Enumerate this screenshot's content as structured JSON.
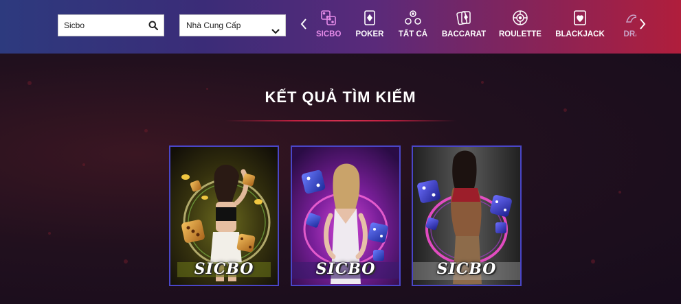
{
  "header": {
    "search": {
      "value": "Sicbo",
      "placeholder": "Sicbo",
      "icon": "search-icon"
    },
    "provider_select": {
      "selected": "Nhà Cung Cấp",
      "icon": "chevron-down-icon"
    },
    "categories": [
      {
        "label": "SICBO",
        "icon": "dice-icon",
        "active": true
      },
      {
        "label": "POKER",
        "icon": "playing-card-icon",
        "active": false
      },
      {
        "label": "TẤT CẢ",
        "icon": "all-games-icon",
        "active": false
      },
      {
        "label": "BACCARAT",
        "icon": "cards-icon",
        "active": false
      },
      {
        "label": "ROULETTE",
        "icon": "roulette-icon",
        "active": false
      },
      {
        "label": "BLACKJACK",
        "icon": "blackjack-icon",
        "active": false
      },
      {
        "label": "DRA",
        "icon": "dragon-icon",
        "active": false
      }
    ],
    "colors": {
      "active": "#e58be8",
      "text": "#ffffff"
    }
  },
  "main": {
    "title": "KẾT QUẢ TÌM KIẾM",
    "results": [
      {
        "label": "SICBO",
        "theme": "gold"
      },
      {
        "label": "SICBO",
        "theme": "purple"
      },
      {
        "label": "SICBO",
        "theme": "silver"
      }
    ]
  }
}
